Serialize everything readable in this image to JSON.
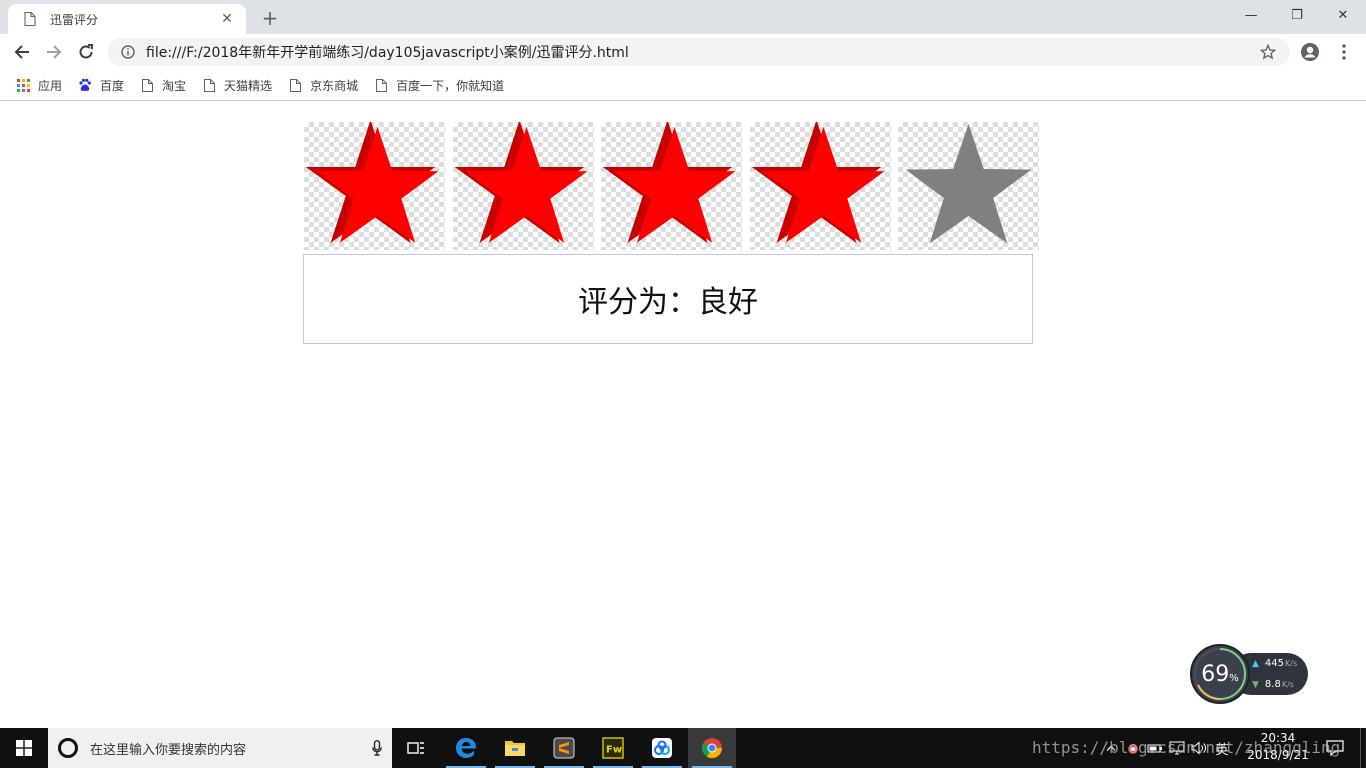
{
  "browser": {
    "tab": {
      "title": "迅雷评分",
      "favicon": "file-icon",
      "close": "✕"
    },
    "new_tab": "+",
    "window_controls": {
      "minimize": "—",
      "maximize": "❐",
      "close": "✕"
    },
    "url": "file:///F:/2018年新年开学前端练习/day105javascript小案例/迅雷评分.html",
    "bookmarks": [
      {
        "label": "应用",
        "icon": "apps-grid-icon"
      },
      {
        "label": "百度",
        "icon": "baidu-paw-icon"
      },
      {
        "label": "淘宝",
        "icon": "file-icon"
      },
      {
        "label": "天猫精选",
        "icon": "file-icon"
      },
      {
        "label": "京东商城",
        "icon": "file-icon"
      },
      {
        "label": "百度一下，你就知道",
        "icon": "file-icon"
      }
    ]
  },
  "page": {
    "rating": {
      "filled": 4,
      "total": 5
    },
    "rating_text": "评分为：良好",
    "colors": {
      "star_filled": "#ff0000",
      "star_filled_shade": "#c80000",
      "star_empty": "#808080"
    }
  },
  "net_widget": {
    "percent": "69",
    "percent_unit": "%",
    "upload_value": "445",
    "upload_unit": "K/s",
    "download_value": "8.8",
    "download_unit": "K/s"
  },
  "taskbar": {
    "search_placeholder": "在这里输入你要搜索的内容",
    "apps": [
      "task-view",
      "edge",
      "file-explorer",
      "sublime-text",
      "fireworks",
      "baidu-netdisk",
      "chrome"
    ],
    "tray_lang": "英",
    "time": "20:34",
    "date": "2018/9/21"
  },
  "watermark": "https://blog.csdn.net/zhangqling"
}
